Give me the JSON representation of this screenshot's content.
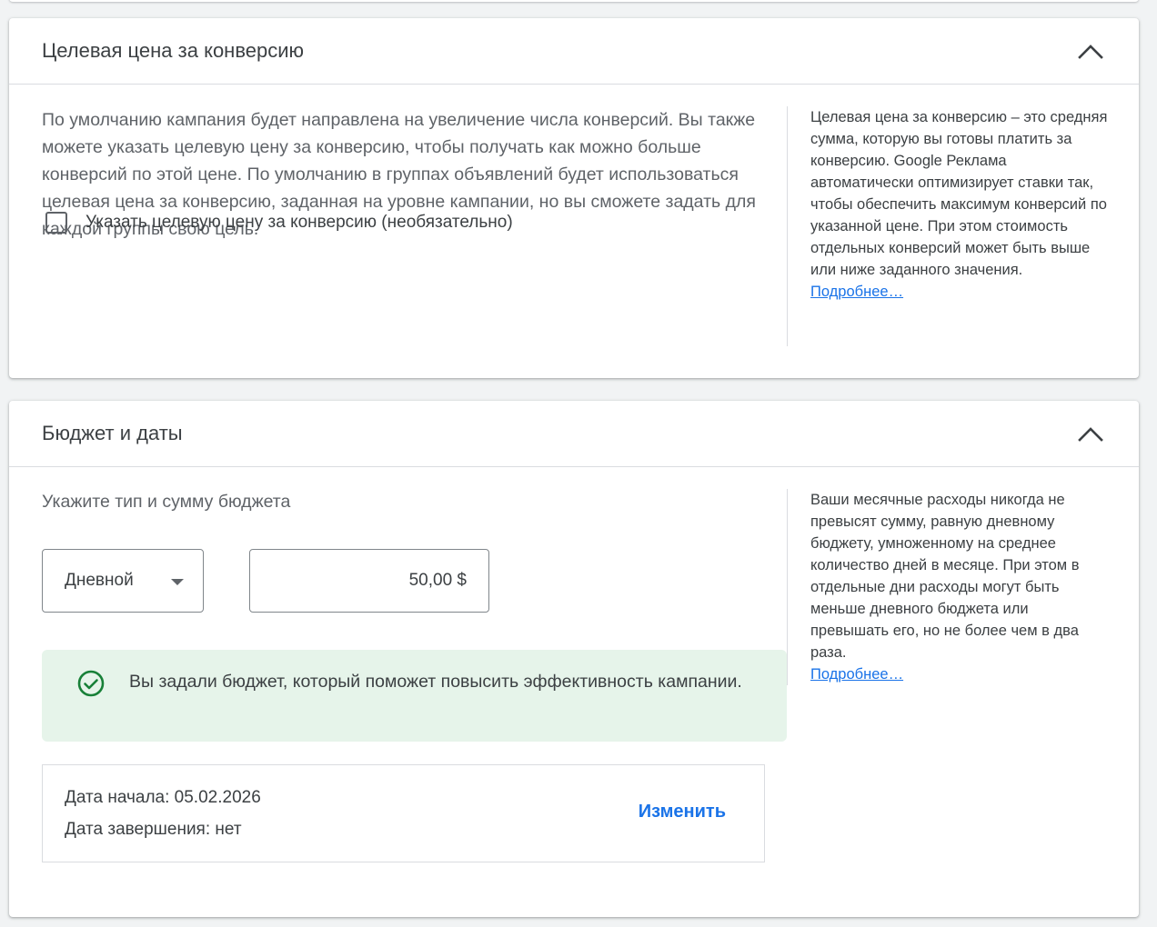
{
  "cpa_section": {
    "title": "Целевая цена за конверсию",
    "description": "По умолчанию кампания будет направлена на увеличение числа конверсий. Вы также можете указать целевую цену за конверсию, чтобы получать как можно больше конверсий по этой цене. По умолчанию в группах объявлений будет использоваться целевая цена за конверсию, заданная на уровне кампании, но вы сможете задать для каждой группы свою цель.",
    "checkbox_label": "Указать целевую цену за конверсию (необязательно)",
    "checkbox_checked": false,
    "help_text": "Целевая цена за конверсию – это средняя сумма, которую вы готовы платить за конверсию. Google Реклама автоматически оптимизирует ставки так, чтобы обеспечить максимум конверсий по указанной цене. При этом стоимость отдельных конверсий может быть выше или ниже заданного значения.",
    "help_link": "Подробнее…"
  },
  "budget_section": {
    "title": "Бюджет и даты",
    "subtitle": "Укажите тип и сумму бюджета",
    "budget_type": "Дневной",
    "budget_amount": "50,00 $",
    "success_message": "Вы задали бюджет, который поможет повысить эффективность кампании.",
    "start_date": "Дата начала: 05.02.2026",
    "end_date": "Дата завершения: нет",
    "change_link": "Изменить",
    "help_text": "Ваши месячные расходы никогда не превысят сумму, равную дневному бюджету, умноженному на среднее количество дней в месяце. При этом в отдельные дни расходы могут быть меньше дневного бюджета или превышать его, но не более чем в два раза.",
    "help_link": "Подробнее…"
  },
  "colors": {
    "accent": "#1a73e8",
    "success_bg": "#e6f4ea",
    "success_icon": "#188038"
  },
  "icons": {
    "collapse": "chevron-up-icon",
    "success": "check-circle-icon",
    "dropdown": "caret-down-icon"
  }
}
